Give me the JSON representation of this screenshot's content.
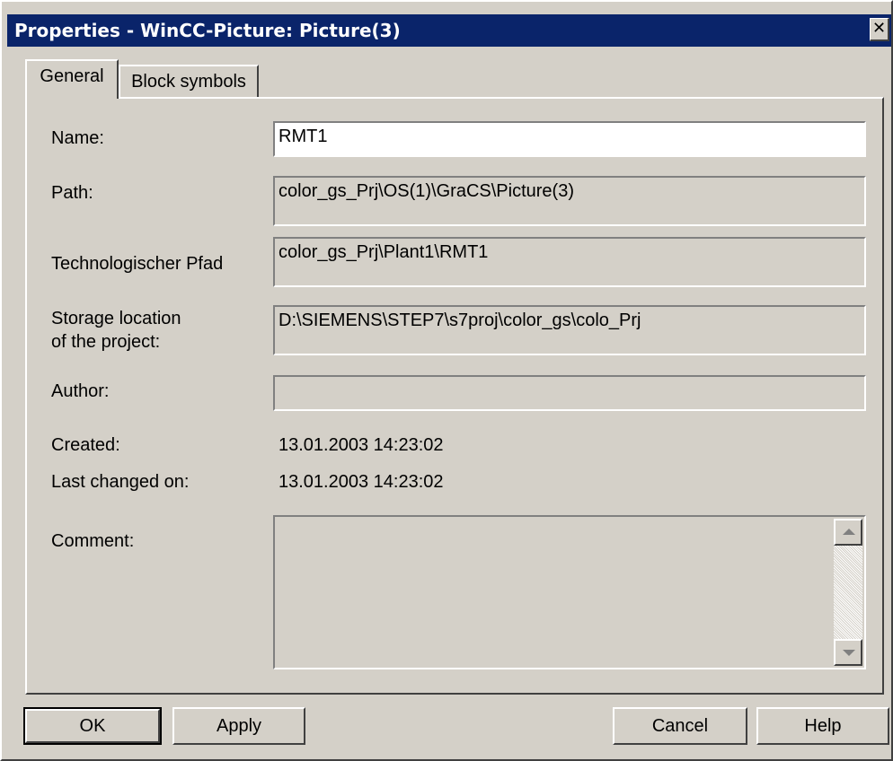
{
  "window": {
    "title": "Properties - WinCC-Picture: Picture(3)",
    "close_glyph": "✕"
  },
  "tabs": [
    {
      "label": "General",
      "selected": true
    },
    {
      "label": "Block symbols",
      "selected": false
    }
  ],
  "form": {
    "name_label": "Name:",
    "name_value": "RMT1",
    "path_label": "Path:",
    "path_value": "color_gs_Prj\\OS(1)\\GraCS\\Picture(3)",
    "tech_path_label": "Technologischer Pfad",
    "tech_path_value": "color_gs_Prj\\Plant1\\RMT1",
    "storage_label_line1": "Storage location",
    "storage_label_line2": "of the project:",
    "storage_value": "D:\\SIEMENS\\STEP7\\s7proj\\color_gs\\colo_Prj",
    "author_label": "Author:",
    "author_value": "",
    "created_label": "Created:",
    "created_value": "13.01.2003  14:23:02",
    "last_changed_label": "Last changed on:",
    "last_changed_value": "13.01.2003  14:23:02",
    "comment_label": "Comment:",
    "comment_value": ""
  },
  "buttons": {
    "ok": "OK",
    "apply": "Apply",
    "cancel": "Cancel",
    "help": "Help"
  },
  "colors": {
    "title_bar": "#0a246a",
    "face": "#d4d0c8"
  }
}
